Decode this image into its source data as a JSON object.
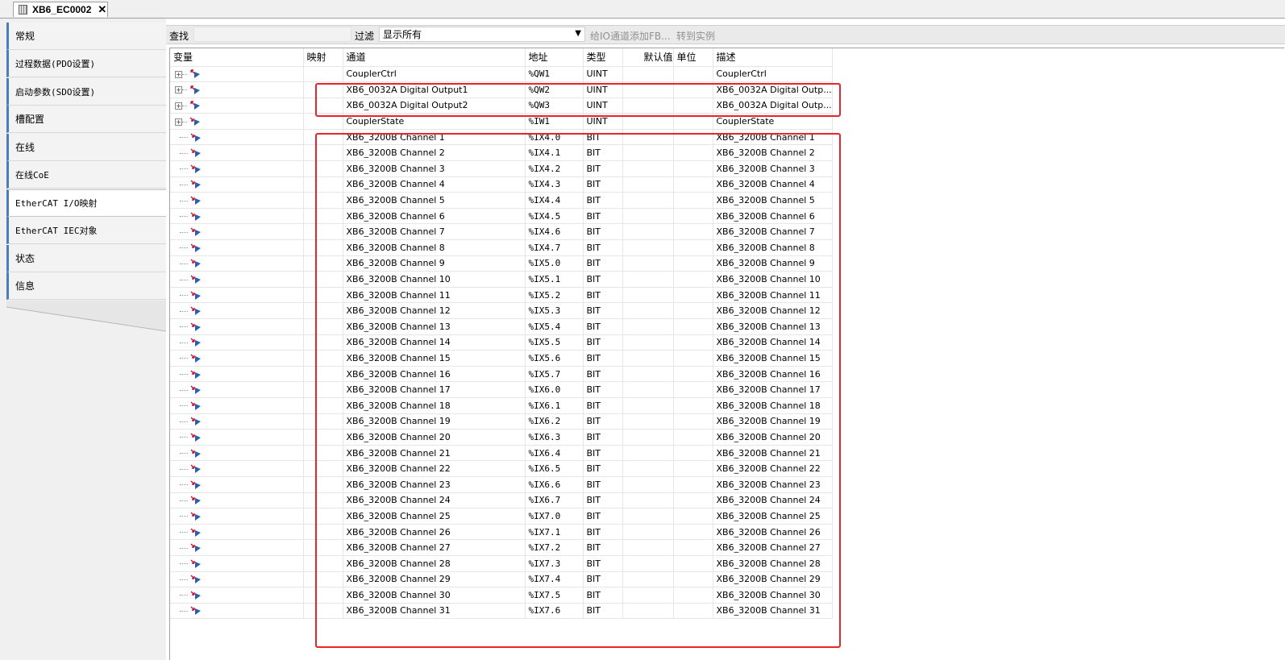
{
  "document_tab": {
    "title": "XB6_EC0002",
    "close": "✕"
  },
  "nav": {
    "items": [
      {
        "label": "常规"
      },
      {
        "label": "过程数据(PDO设置)"
      },
      {
        "label": "启动参数(SDO设置)"
      },
      {
        "label": "槽配置"
      },
      {
        "label": "在线"
      },
      {
        "label": "在线CoE"
      },
      {
        "label": "EtherCAT I/O映射"
      },
      {
        "label": "EtherCAT IEC对象"
      },
      {
        "label": "状态"
      },
      {
        "label": "信息"
      }
    ],
    "active_index": 6
  },
  "toolbar": {
    "find_label": "查找",
    "find_value": "",
    "filter_label": "过滤",
    "filter_value": "显示所有",
    "add_fb_label": "给IO通道添加FB...",
    "goto_instance_label": "转到实例"
  },
  "table": {
    "columns": [
      "变量",
      "映射",
      "通道",
      "地址",
      "类型",
      "默认值",
      "单位",
      "描述"
    ],
    "rows": [
      {
        "expandable": true,
        "dir": "out",
        "channel": "CouplerCtrl",
        "address": "%QW1",
        "type": "UINT",
        "description": "CouplerCtrl"
      },
      {
        "expandable": true,
        "dir": "out",
        "channel": "XB6_0032A Digital Output1",
        "address": "%QW2",
        "type": "UINT",
        "description": "XB6_0032A Digital Outp..."
      },
      {
        "expandable": true,
        "dir": "out",
        "channel": "XB6_0032A Digital Output2",
        "address": "%QW3",
        "type": "UINT",
        "description": "XB6_0032A Digital Outp..."
      },
      {
        "expandable": true,
        "dir": "in",
        "channel": "CouplerState",
        "address": "%IW1",
        "type": "UINT",
        "description": "CouplerState"
      },
      {
        "expandable": false,
        "dir": "in",
        "channel": "XB6_3200B Channel 1",
        "address": "%IX4.0",
        "type": "BIT",
        "description": "XB6_3200B Channel 1"
      },
      {
        "expandable": false,
        "dir": "in",
        "channel": "XB6_3200B Channel 2",
        "address": "%IX4.1",
        "type": "BIT",
        "description": "XB6_3200B Channel 2"
      },
      {
        "expandable": false,
        "dir": "in",
        "channel": "XB6_3200B Channel 3",
        "address": "%IX4.2",
        "type": "BIT",
        "description": "XB6_3200B Channel 3"
      },
      {
        "expandable": false,
        "dir": "in",
        "channel": "XB6_3200B Channel 4",
        "address": "%IX4.3",
        "type": "BIT",
        "description": "XB6_3200B Channel 4"
      },
      {
        "expandable": false,
        "dir": "in",
        "channel": "XB6_3200B Channel 5",
        "address": "%IX4.4",
        "type": "BIT",
        "description": "XB6_3200B Channel 5"
      },
      {
        "expandable": false,
        "dir": "in",
        "channel": "XB6_3200B Channel 6",
        "address": "%IX4.5",
        "type": "BIT",
        "description": "XB6_3200B Channel 6"
      },
      {
        "expandable": false,
        "dir": "in",
        "channel": "XB6_3200B Channel 7",
        "address": "%IX4.6",
        "type": "BIT",
        "description": "XB6_3200B Channel 7"
      },
      {
        "expandable": false,
        "dir": "in",
        "channel": "XB6_3200B Channel 8",
        "address": "%IX4.7",
        "type": "BIT",
        "description": "XB6_3200B Channel 8"
      },
      {
        "expandable": false,
        "dir": "in",
        "channel": "XB6_3200B Channel 9",
        "address": "%IX5.0",
        "type": "BIT",
        "description": "XB6_3200B Channel 9"
      },
      {
        "expandable": false,
        "dir": "in",
        "channel": "XB6_3200B Channel 10",
        "address": "%IX5.1",
        "type": "BIT",
        "description": "XB6_3200B Channel 10"
      },
      {
        "expandable": false,
        "dir": "in",
        "channel": "XB6_3200B Channel 11",
        "address": "%IX5.2",
        "type": "BIT",
        "description": "XB6_3200B Channel 11"
      },
      {
        "expandable": false,
        "dir": "in",
        "channel": "XB6_3200B Channel 12",
        "address": "%IX5.3",
        "type": "BIT",
        "description": "XB6_3200B Channel 12"
      },
      {
        "expandable": false,
        "dir": "in",
        "channel": "XB6_3200B Channel 13",
        "address": "%IX5.4",
        "type": "BIT",
        "description": "XB6_3200B Channel 13"
      },
      {
        "expandable": false,
        "dir": "in",
        "channel": "XB6_3200B Channel 14",
        "address": "%IX5.5",
        "type": "BIT",
        "description": "XB6_3200B Channel 14"
      },
      {
        "expandable": false,
        "dir": "in",
        "channel": "XB6_3200B Channel 15",
        "address": "%IX5.6",
        "type": "BIT",
        "description": "XB6_3200B Channel 15"
      },
      {
        "expandable": false,
        "dir": "in",
        "channel": "XB6_3200B Channel 16",
        "address": "%IX5.7",
        "type": "BIT",
        "description": "XB6_3200B Channel 16"
      },
      {
        "expandable": false,
        "dir": "in",
        "channel": "XB6_3200B Channel 17",
        "address": "%IX6.0",
        "type": "BIT",
        "description": "XB6_3200B Channel 17"
      },
      {
        "expandable": false,
        "dir": "in",
        "channel": "XB6_3200B Channel 18",
        "address": "%IX6.1",
        "type": "BIT",
        "description": "XB6_3200B Channel 18"
      },
      {
        "expandable": false,
        "dir": "in",
        "channel": "XB6_3200B Channel 19",
        "address": "%IX6.2",
        "type": "BIT",
        "description": "XB6_3200B Channel 19"
      },
      {
        "expandable": false,
        "dir": "in",
        "channel": "XB6_3200B Channel 20",
        "address": "%IX6.3",
        "type": "BIT",
        "description": "XB6_3200B Channel 20"
      },
      {
        "expandable": false,
        "dir": "in",
        "channel": "XB6_3200B Channel 21",
        "address": "%IX6.4",
        "type": "BIT",
        "description": "XB6_3200B Channel 21"
      },
      {
        "expandable": false,
        "dir": "in",
        "channel": "XB6_3200B Channel 22",
        "address": "%IX6.5",
        "type": "BIT",
        "description": "XB6_3200B Channel 22"
      },
      {
        "expandable": false,
        "dir": "in",
        "channel": "XB6_3200B Channel 23",
        "address": "%IX6.6",
        "type": "BIT",
        "description": "XB6_3200B Channel 23"
      },
      {
        "expandable": false,
        "dir": "in",
        "channel": "XB6_3200B Channel 24",
        "address": "%IX6.7",
        "type": "BIT",
        "description": "XB6_3200B Channel 24"
      },
      {
        "expandable": false,
        "dir": "in",
        "channel": "XB6_3200B Channel 25",
        "address": "%IX7.0",
        "type": "BIT",
        "description": "XB6_3200B Channel 25"
      },
      {
        "expandable": false,
        "dir": "in",
        "channel": "XB6_3200B Channel 26",
        "address": "%IX7.1",
        "type": "BIT",
        "description": "XB6_3200B Channel 26"
      },
      {
        "expandable": false,
        "dir": "in",
        "channel": "XB6_3200B Channel 27",
        "address": "%IX7.2",
        "type": "BIT",
        "description": "XB6_3200B Channel 27"
      },
      {
        "expandable": false,
        "dir": "in",
        "channel": "XB6_3200B Channel 28",
        "address": "%IX7.3",
        "type": "BIT",
        "description": "XB6_3200B Channel 28"
      },
      {
        "expandable": false,
        "dir": "in",
        "channel": "XB6_3200B Channel 29",
        "address": "%IX7.4",
        "type": "BIT",
        "description": "XB6_3200B Channel 29"
      },
      {
        "expandable": false,
        "dir": "in",
        "channel": "XB6_3200B Channel 30",
        "address": "%IX7.5",
        "type": "BIT",
        "description": "XB6_3200B Channel 30"
      },
      {
        "expandable": false,
        "dir": "in",
        "channel": "XB6_3200B Channel 31",
        "address": "%IX7.6",
        "type": "BIT",
        "description": "XB6_3200B Channel 31"
      }
    ]
  },
  "icons": {
    "expander": "plus-box-icon",
    "output_variable": "output-variable-icon",
    "input_variable": "input-variable-icon",
    "document": "device-document-icon"
  },
  "colors": {
    "highlight": "#e8262a",
    "nav_accent": "#4a7ebb",
    "icon_blue": "#2a5fb0",
    "icon_red": "#c8102e"
  }
}
